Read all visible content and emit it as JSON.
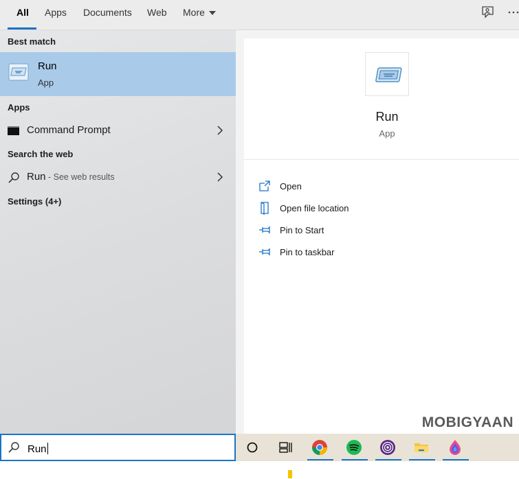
{
  "tabs": [
    {
      "label": "All",
      "active": true
    },
    {
      "label": "Apps",
      "active": false
    },
    {
      "label": "Documents",
      "active": false
    },
    {
      "label": "Web",
      "active": false
    },
    {
      "label": "More",
      "active": false
    }
  ],
  "top_icons": {
    "feedback": "feedback-icon",
    "more": "ellipsis-icon"
  },
  "left": {
    "best_match_header": "Best match",
    "best_match": {
      "title": "Run",
      "subtitle": "App",
      "icon": "run-app-icon"
    },
    "apps_header": "Apps",
    "apps": [
      {
        "label": "Command Prompt",
        "icon": "command-prompt-icon"
      }
    ],
    "web_header": "Search the web",
    "web": {
      "query": "Run",
      "suffix": " - See web results"
    },
    "settings_header": "Settings (4+)"
  },
  "detail": {
    "title": "Run",
    "subtitle": "App",
    "actions": [
      {
        "label": "Open",
        "icon": "open-icon"
      },
      {
        "label": "Open file location",
        "icon": "file-location-icon"
      },
      {
        "label": "Pin to Start",
        "icon": "pin-icon"
      },
      {
        "label": "Pin to taskbar",
        "icon": "pin-icon"
      }
    ]
  },
  "watermark": "MOBIGYAAN",
  "taskbar": {
    "search_value": "Run",
    "icons": [
      "cortana-icon",
      "task-view-icon",
      "chrome-icon",
      "spotify-icon",
      "tor-browser-icon",
      "file-explorer-icon",
      "firefox-nightly-icon"
    ]
  },
  "colors": {
    "accent": "#1a73c6",
    "selection": "#a9cbe9",
    "taskbar": "#e9e3d7"
  }
}
